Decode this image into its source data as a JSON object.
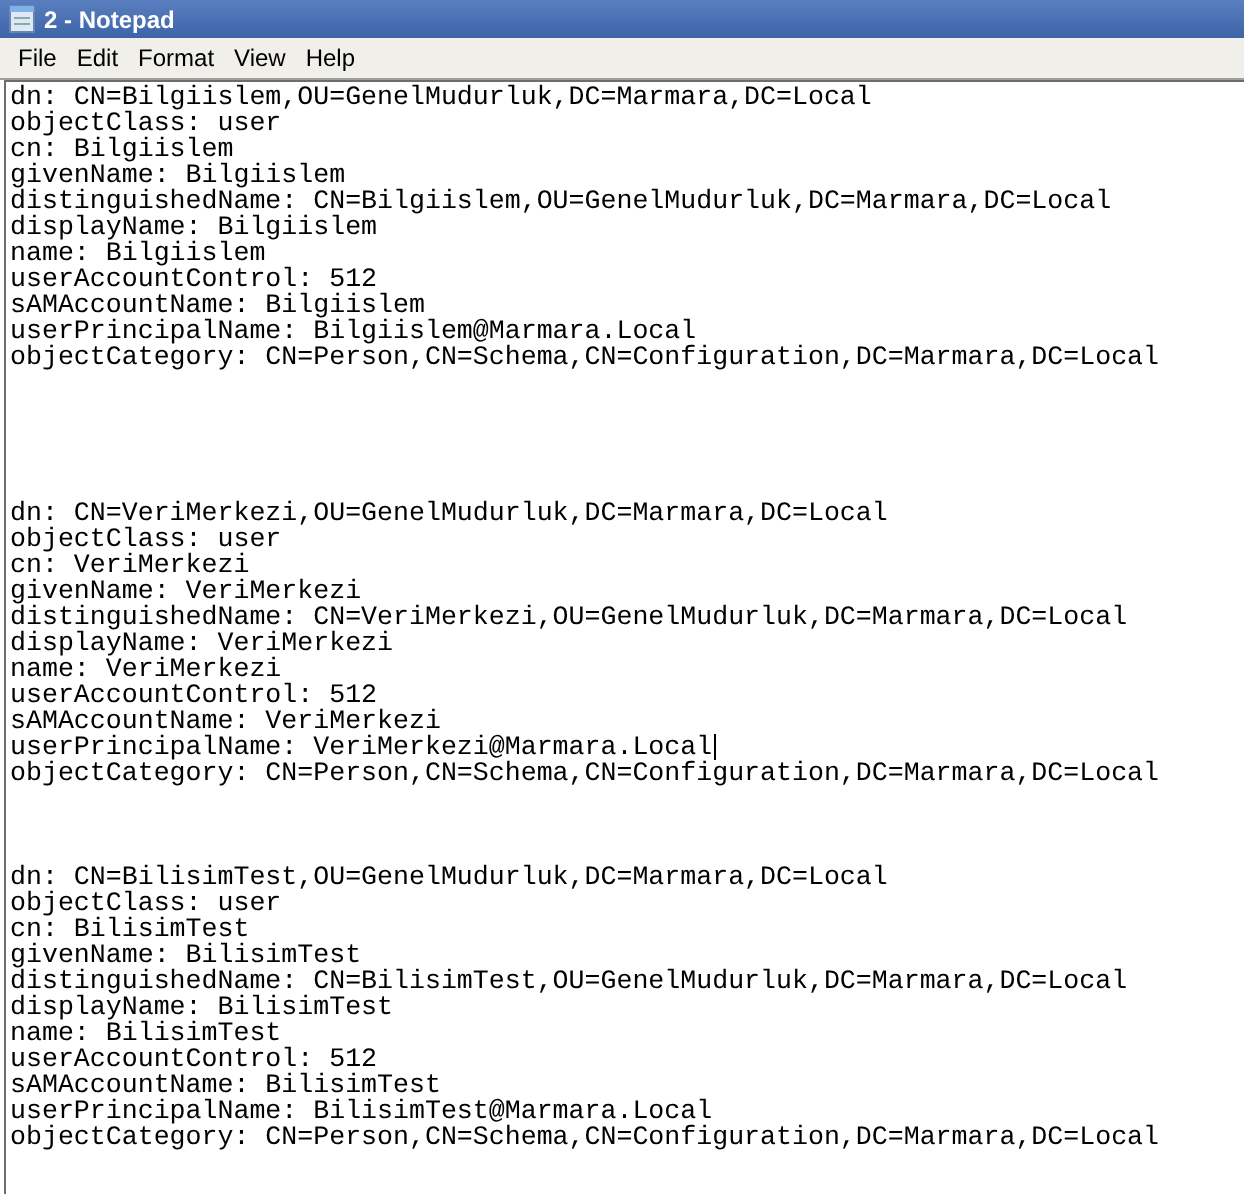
{
  "window": {
    "title": "2 - Notepad"
  },
  "menu": [
    "File",
    "Edit",
    "Format",
    "View",
    "Help"
  ],
  "lines": [
    {
      "kind": "text",
      "text": "dn: CN=Bilgiislem,OU=GenelMudurluk,DC=Marmara,DC=Local",
      "caret": false
    },
    {
      "kind": "text",
      "text": "objectClass: user",
      "caret": false
    },
    {
      "kind": "text",
      "text": "cn: Bilgiislem",
      "caret": false
    },
    {
      "kind": "text",
      "text": "givenName: Bilgiislem",
      "caret": false
    },
    {
      "kind": "text",
      "text": "distinguishedName: CN=Bilgiislem,OU=GenelMudurluk,DC=Marmara,DC=Local",
      "caret": false
    },
    {
      "kind": "text",
      "text": "displayName: Bilgiislem",
      "caret": false
    },
    {
      "kind": "text",
      "text": "name: Bilgiislem",
      "caret": false
    },
    {
      "kind": "text",
      "text": "userAccountControl: 512",
      "caret": false
    },
    {
      "kind": "text",
      "text": "sAMAccountName: Bilgiislem",
      "caret": false
    },
    {
      "kind": "text",
      "text": "userPrincipalName: Bilgiislem@Marmara.Local",
      "caret": false
    },
    {
      "kind": "text",
      "text": "objectCategory: CN=Person,CN=Schema,CN=Configuration,DC=Marmara,DC=Local",
      "caret": false
    },
    {
      "kind": "blank"
    },
    {
      "kind": "blank"
    },
    {
      "kind": "blank"
    },
    {
      "kind": "blank"
    },
    {
      "kind": "blank"
    },
    {
      "kind": "text",
      "text": "dn: CN=VeriMerkezi,OU=GenelMudurluk,DC=Marmara,DC=Local",
      "caret": false
    },
    {
      "kind": "text",
      "text": "objectClass: user",
      "caret": false
    },
    {
      "kind": "text",
      "text": "cn: VeriMerkezi",
      "caret": false
    },
    {
      "kind": "text",
      "text": "givenName: VeriMerkezi",
      "caret": false
    },
    {
      "kind": "text",
      "text": "distinguishedName: CN=VeriMerkezi,OU=GenelMudurluk,DC=Marmara,DC=Local",
      "caret": false
    },
    {
      "kind": "text",
      "text": "displayName: VeriMerkezi",
      "caret": false
    },
    {
      "kind": "text",
      "text": "name: VeriMerkezi",
      "caret": false
    },
    {
      "kind": "text",
      "text": "userAccountControl: 512",
      "caret": false
    },
    {
      "kind": "text",
      "text": "sAMAccountName: VeriMerkezi",
      "caret": false
    },
    {
      "kind": "text",
      "text": "userPrincipalName: VeriMerkezi@Marmara.Local",
      "caret": true
    },
    {
      "kind": "text",
      "text": "objectCategory: CN=Person,CN=Schema,CN=Configuration,DC=Marmara,DC=Local",
      "caret": false
    },
    {
      "kind": "blank"
    },
    {
      "kind": "blank"
    },
    {
      "kind": "blank"
    },
    {
      "kind": "text",
      "text": "dn: CN=BilisimTest,OU=GenelMudurluk,DC=Marmara,DC=Local",
      "caret": false
    },
    {
      "kind": "text",
      "text": "objectClass: user",
      "caret": false
    },
    {
      "kind": "text",
      "text": "cn: BilisimTest",
      "caret": false
    },
    {
      "kind": "text",
      "text": "givenName: BilisimTest",
      "caret": false
    },
    {
      "kind": "text",
      "text": "distinguishedName: CN=BilisimTest,OU=GenelMudurluk,DC=Marmara,DC=Local",
      "caret": false
    },
    {
      "kind": "text",
      "text": "displayName: BilisimTest",
      "caret": false
    },
    {
      "kind": "text",
      "text": "name: BilisimTest",
      "caret": false
    },
    {
      "kind": "text",
      "text": "userAccountControl: 512",
      "caret": false
    },
    {
      "kind": "text",
      "text": "sAMAccountName: BilisimTest",
      "caret": false
    },
    {
      "kind": "text",
      "text": "userPrincipalName: BilisimTest@Marmara.Local",
      "caret": false
    },
    {
      "kind": "text",
      "text": "objectCategory: CN=Person,CN=Schema,CN=Configuration,DC=Marmara,DC=Local",
      "caret": false
    }
  ]
}
